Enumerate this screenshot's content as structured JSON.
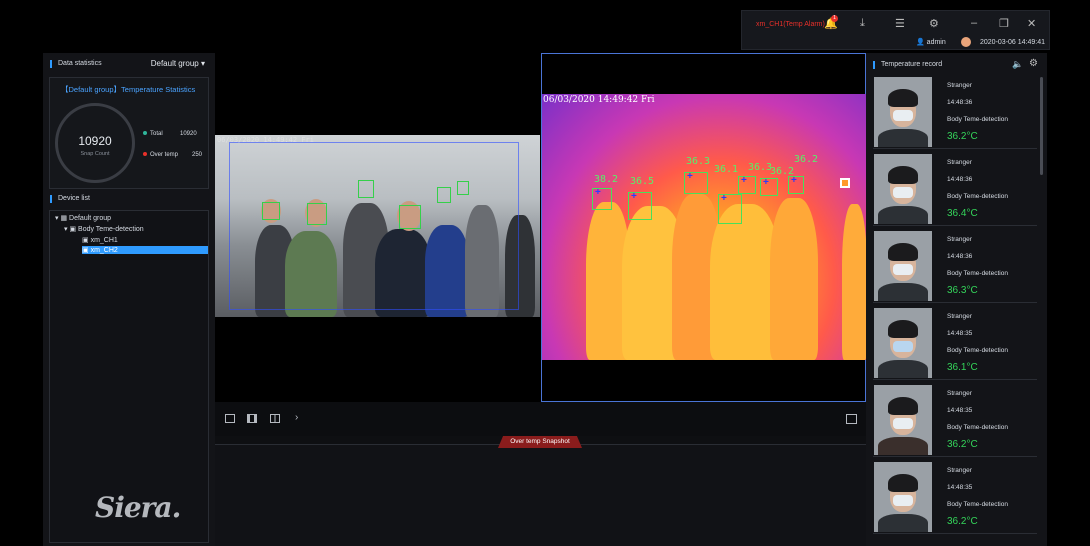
{
  "topbar": {
    "alarm": "xm_CH1(Temp Alarm)",
    "badge": "1",
    "user": "admin",
    "datetime": "2020-03-06 14:49:41"
  },
  "left": {
    "stats_title": "Data statistics",
    "group_select": "Default group ▾",
    "box_title": "【Default group】Temperature Statistics",
    "snap_count": "10920",
    "snap_label": "Snap Count",
    "total_label": "Total",
    "total_value": "10920",
    "over_label": "Over temp",
    "over_value": "250",
    "device_title": "Device list",
    "tree": [
      "Default group",
      "Body Teme-detection",
      "xm_CH1",
      "xm_CH2"
    ],
    "logo": "Siera."
  },
  "video": {
    "cam1_timestamp": "06/03/2020 14:49:42 Fri",
    "cam2_timestamp": "06/03/2020 14:49:42 Fri",
    "temps": [
      "38.2",
      "36.5",
      "36.3",
      "36.1",
      "36.3",
      "36.2",
      "36.2"
    ]
  },
  "snapshot_tab": "Over temp Snapshot",
  "right": {
    "title": "Temperature record",
    "records": [
      {
        "name": "Stranger",
        "time": "14:48:36",
        "type": "Body Teme-detection",
        "temp": "36.2°C"
      },
      {
        "name": "Stranger",
        "time": "14:48:36",
        "type": "Body Teme-detection",
        "temp": "36.4°C"
      },
      {
        "name": "Stranger",
        "time": "14:48:36",
        "type": "Body Teme-detection",
        "temp": "36.3°C"
      },
      {
        "name": "Stranger",
        "time": "14:48:35",
        "type": "Body Teme-detection",
        "temp": "36.1°C"
      },
      {
        "name": "Stranger",
        "time": "14:48:35",
        "type": "Body Teme-detection",
        "temp": "36.2°C"
      },
      {
        "name": "Stranger",
        "time": "14:48:35",
        "type": "Body Teme-detection",
        "temp": "36.2°C"
      }
    ]
  }
}
